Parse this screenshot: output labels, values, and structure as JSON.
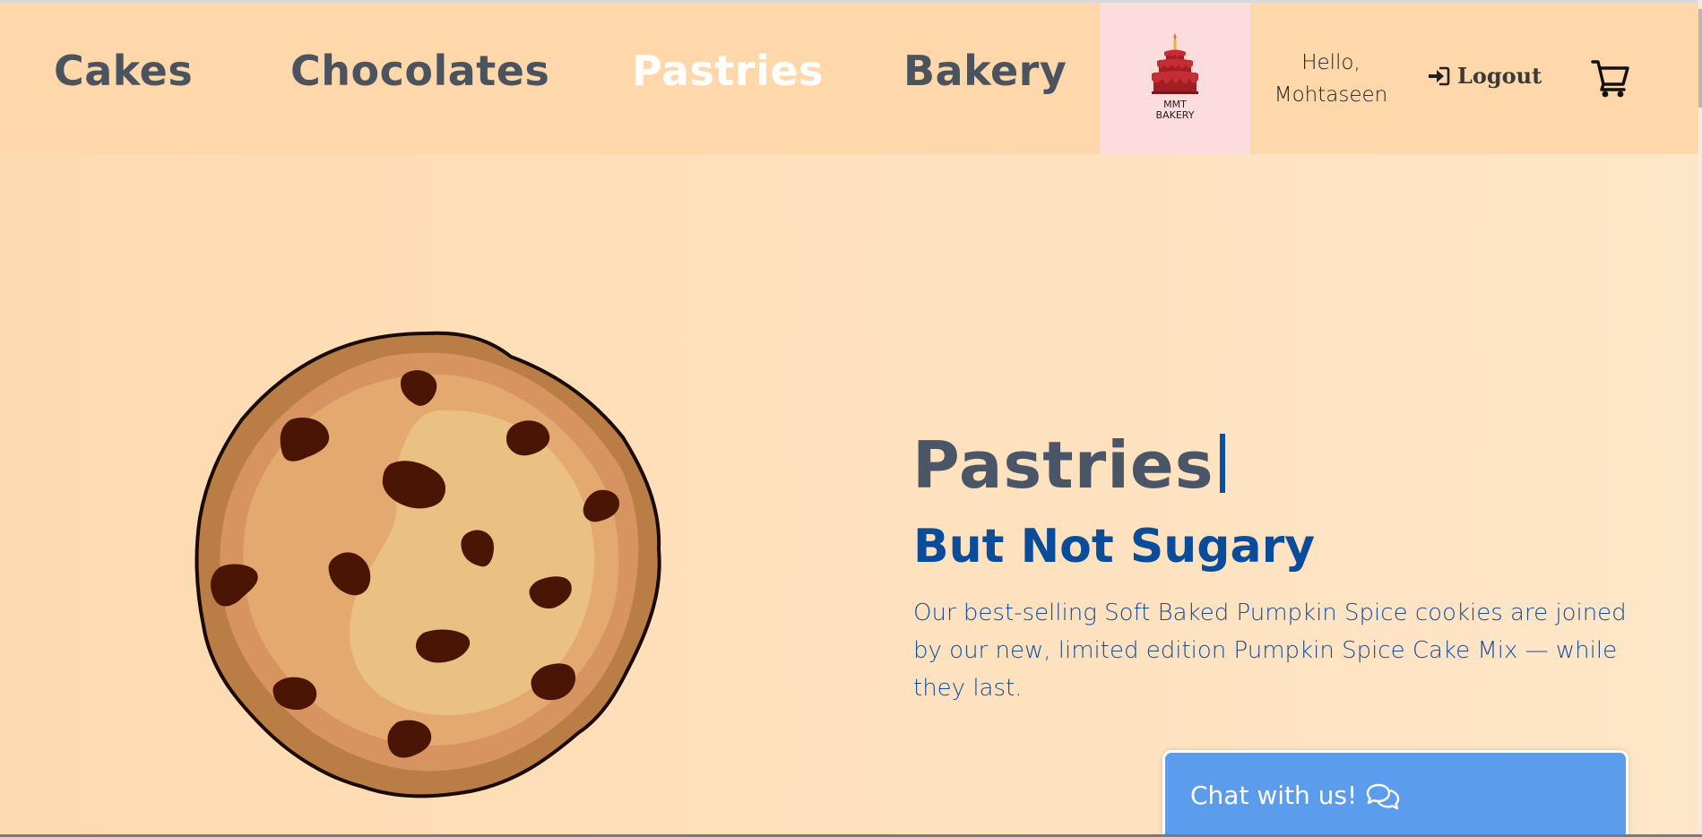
{
  "nav": {
    "links": [
      {
        "label": "Cakes"
      },
      {
        "label": "Chocolates"
      },
      {
        "label": "Pastries"
      },
      {
        "label": "Bakery"
      }
    ],
    "active": "Pastries",
    "logo_text": "MMT\nBAKERY",
    "greeting": "Hello, Mohtaseen",
    "logout_label": "Logout"
  },
  "icons": {
    "logo": "cake-logo-icon",
    "logout": "sign-in-arrow-icon",
    "cart": "shopping-cart-icon",
    "chat": "chat-bubbles-icon",
    "hero_image": "chocolate-chip-cookie"
  },
  "hero": {
    "title": "Pastries",
    "subtitle": "But Not Sugary",
    "description": "Our best-selling Soft Baked Pumpkin Spice cookies are joined by our new, limited edition Pumpkin Spice Cake Mix — while they last."
  },
  "chat": {
    "label": "Chat with us!"
  },
  "colors": {
    "navbar_bg": "#fed8aa",
    "logo_bg": "#fcdcdc",
    "nav_text": "#4b535f",
    "nav_active": "#ffffff",
    "hero_title": "#4a5568",
    "hero_subtitle": "#0b4c9a",
    "hero_desc": "#174d9e",
    "chat_bg": "#5c9ced",
    "cookie_dough": "#e1a970",
    "cookie_chip": "#4a1505"
  }
}
